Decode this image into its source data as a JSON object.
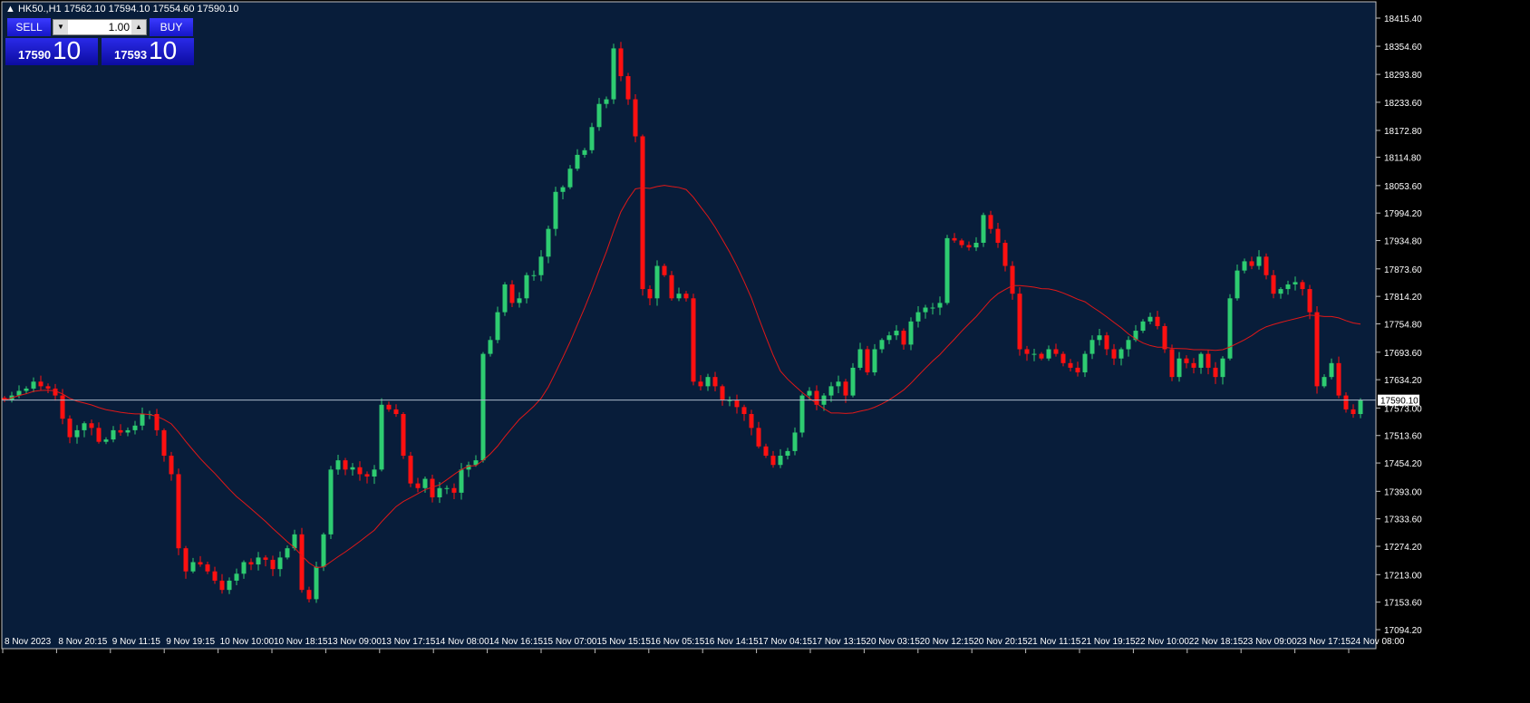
{
  "header": {
    "title": "HK50.,H1  17562.10 17594.10 17554.60 17590.10"
  },
  "trade_panel": {
    "sell_label": "SELL",
    "buy_label": "BUY",
    "lot": "1.00",
    "down_arrow": "▼",
    "up_arrow": "▲",
    "sell_price_main": "17590",
    "sell_price_big": "10",
    "buy_price_main": "17593",
    "buy_price_big": "10"
  },
  "colors": {
    "background": "#081d3a",
    "up": "#2ecc71",
    "down": "#ff1010",
    "ma": "#e01818",
    "price_line": "#a8b8c8",
    "frame": "#c0c0c0"
  },
  "chart_data": {
    "type": "candlestick",
    "symbol": "HK50.",
    "timeframe": "H1",
    "ylim": [
      17094.2,
      18415.4
    ],
    "current_price_label": "17590.10",
    "current_price": 17590.1,
    "ma_period": 20,
    "closes": [
      17590,
      17600,
      17610,
      17615,
      17630,
      17620,
      17615,
      17600,
      17550,
      17510,
      17525,
      17540,
      17530,
      17500,
      17505,
      17525,
      17520,
      17525,
      17535,
      17560,
      17560,
      17525,
      17470,
      17430,
      17270,
      17220,
      17240,
      17235,
      17220,
      17200,
      17180,
      17200,
      17215,
      17240,
      17235,
      17250,
      17245,
      17225,
      17250,
      17270,
      17300,
      17180,
      17160,
      17230,
      17300,
      17440,
      17460,
      17440,
      17445,
      17430,
      17425,
      17440,
      17580,
      17570,
      17560,
      17470,
      17410,
      17400,
      17420,
      17380,
      17400,
      17400,
      17390,
      17440,
      17450,
      17460,
      17690,
      17720,
      17780,
      17840,
      17800,
      17810,
      17860,
      17860,
      17900,
      17960,
      18040,
      18050,
      18090,
      18120,
      18130,
      18180,
      18230,
      18240,
      18350,
      18290,
      18240,
      18160,
      17830,
      17810,
      17880,
      17860,
      17810,
      17820,
      17810,
      17630,
      17620,
      17640,
      17620,
      17590,
      17590,
      17575,
      17560,
      17530,
      17490,
      17470,
      17450,
      17470,
      17480,
      17520,
      17600,
      17610,
      17580,
      17600,
      17620,
      17630,
      17600,
      17660,
      17700,
      17650,
      17700,
      17720,
      17730,
      17740,
      17710,
      17760,
      17780,
      17790,
      17790,
      17800,
      17940,
      17935,
      17925,
      17920,
      17930,
      17990,
      17960,
      17930,
      17880,
      17820,
      17700,
      17690,
      17690,
      17680,
      17700,
      17690,
      17670,
      17660,
      17650,
      17690,
      17720,
      17730,
      17700,
      17680,
      17700,
      17720,
      17740,
      17760,
      17770,
      17750,
      17700,
      17640,
      17680,
      17670,
      17660,
      17690,
      17660,
      17640,
      17680,
      17810,
      17870,
      17890,
      17880,
      17900,
      17860,
      17820,
      17830,
      17840,
      17845,
      17830,
      17780,
      17620,
      17640,
      17670,
      17600,
      17570,
      17560,
      17590.1
    ],
    "y_ticks": [
      "18415.40",
      "18354.60",
      "18293.80",
      "18233.60",
      "18172.80",
      "18114.80",
      "18053.60",
      "17994.20",
      "17934.80",
      "17873.60",
      "17814.20",
      "17754.80",
      "17693.60",
      "17634.20",
      "17573.00",
      "17513.60",
      "17454.20",
      "17393.00",
      "17333.60",
      "17274.20",
      "17213.00",
      "17153.60",
      "17094.20"
    ],
    "x_ticks": [
      "8 Nov 2023",
      "8 Nov 20:15",
      "9 Nov 11:15",
      "9 Nov 19:15",
      "10 Nov 10:00",
      "10 Nov 18:15",
      "13 Nov 09:00",
      "13 Nov 17:15",
      "14 Nov 08:00",
      "14 Nov 16:15",
      "15 Nov 07:00",
      "15 Nov 15:15",
      "16 Nov 05:15",
      "16 Nov 14:15",
      "17 Nov 04:15",
      "17 Nov 13:15",
      "20 Nov 03:15",
      "20 Nov 12:15",
      "20 Nov 20:15",
      "21 Nov 11:15",
      "21 Nov 19:15",
      "22 Nov 10:00",
      "22 Nov 18:15",
      "23 Nov 09:00",
      "23 Nov 17:15",
      "24 Nov 08:00"
    ]
  }
}
